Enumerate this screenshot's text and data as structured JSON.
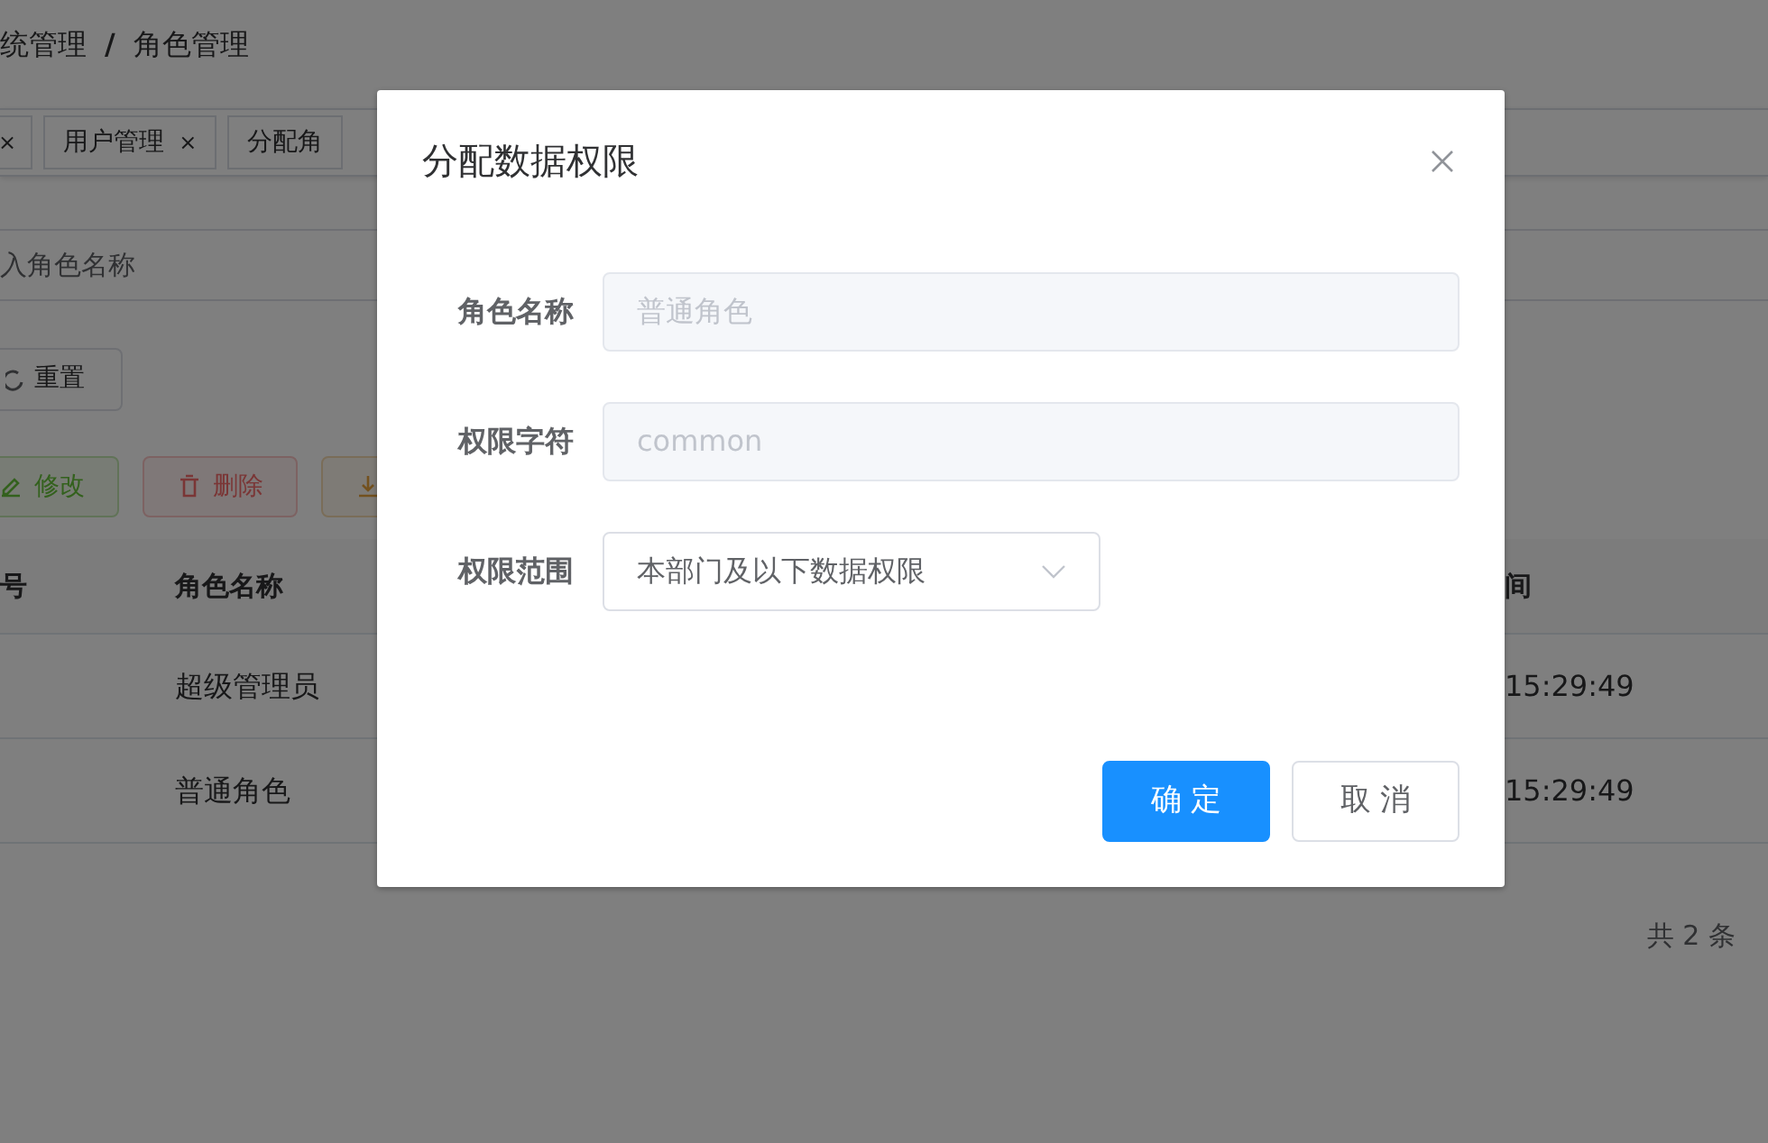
{
  "breadcrumb": {
    "items": [
      "统管理",
      "角色管理"
    ],
    "separator": "/"
  },
  "tags": [
    {
      "close": "×"
    },
    {
      "label": "用户管理",
      "close": "×"
    },
    {
      "label": "分配角"
    }
  ],
  "search": {
    "placeholder": "入角色名称"
  },
  "reset_button": "重置",
  "action_buttons": [
    {
      "label": "修改",
      "kind": "success"
    },
    {
      "label": "删除",
      "kind": "danger"
    },
    {
      "kind": "warning"
    }
  ],
  "table": {
    "columns": [
      "号",
      "角色名称",
      "间"
    ],
    "rows": [
      {
        "column_2": "超级管理员",
        "column_3": "15:29:49"
      },
      {
        "column_2": "普通角色",
        "column_3": "15:29:49"
      }
    ]
  },
  "pagination": {
    "total": "共 2 条"
  },
  "dialog": {
    "title": "分配数据权限",
    "fields": [
      {
        "label": "角色名称",
        "kind": "input",
        "value": "普通角色",
        "disabled": true
      },
      {
        "label": "权限字符",
        "kind": "input",
        "value": "common",
        "disabled": true
      },
      {
        "label": "权限范围",
        "kind": "select",
        "value": "本部门及以下数据权限"
      }
    ],
    "buttons": [
      {
        "label": "确 定",
        "kind": "primary"
      },
      {
        "label": "取 消",
        "kind": "default"
      }
    ]
  }
}
